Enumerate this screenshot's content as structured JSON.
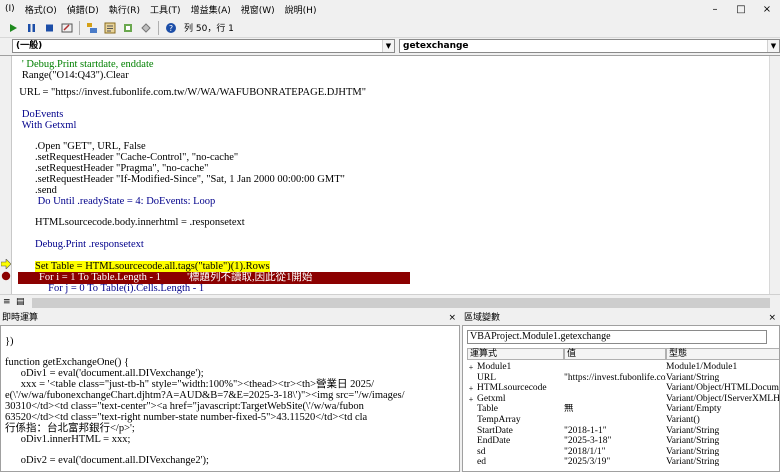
{
  "menu": {
    "items": [
      "(I)",
      "格式(O)",
      "偵錯(D)",
      "執行(R)",
      "工具(T)",
      "增益集(A)",
      "視窗(W)",
      "說明(H)"
    ]
  },
  "window_controls": [
    "–",
    "□",
    "×"
  ],
  "toolbar": {
    "position": "列 50，行 1"
  },
  "dropdowns": {
    "object": "(一般)",
    "procedure": "getexchange"
  },
  "code": {
    "lines": [
      {
        "indent": "   ",
        "text": "' Debug.Print startdate, enddate",
        "style": "comment"
      },
      {
        "indent": "   ",
        "text": "Range(\"O14:Q43\").Clear",
        "style": "normal"
      },
      {
        "indent": "",
        "text": "",
        "style": "normal"
      },
      {
        "indent": "  ",
        "text": "URL = \"https://invest.fubonlife.com.tw/W/WA/WAFUBONRATEPAGE.DJHTM\"",
        "style": "normal"
      },
      {
        "indent": "",
        "text": "",
        "style": "normal"
      },
      {
        "indent": "   ",
        "text": "DoEvents",
        "style": "keyword"
      },
      {
        "indent": "   ",
        "text": "With Getxml",
        "style": "keyword"
      },
      {
        "indent": "",
        "text": "",
        "style": "normal"
      },
      {
        "indent": "        ",
        "text": ".Open \"GET\", URL, False",
        "style": "normal"
      },
      {
        "indent": "        ",
        "text": ".setRequestHeader \"Cache-Control\", \"no-cache\"",
        "style": "normal"
      },
      {
        "indent": "        ",
        "text": ".setRequestHeader \"Pragma\", \"no-cache\"",
        "style": "normal"
      },
      {
        "indent": "        ",
        "text": ".setRequestHeader \"If-Modified-Since\", \"Sat, 1 Jan 2000 00:00:00 GMT\"",
        "style": "normal"
      },
      {
        "indent": "        ",
        "text": ".send",
        "style": "normal"
      },
      {
        "indent": "         ",
        "text": "Do Until .readyState = 4: DoEvents: Loop",
        "style": "keyword"
      },
      {
        "indent": "",
        "text": "",
        "style": "normal"
      },
      {
        "indent": "        ",
        "text": "HTMLsourcecode.body.innerhtml = .responsetext",
        "style": "normal"
      },
      {
        "indent": "",
        "text": "",
        "style": "normal"
      },
      {
        "indent": "        ",
        "text": "Debug.Print .responsetext",
        "style": "keyword"
      },
      {
        "indent": "",
        "text": "",
        "style": "normal"
      },
      {
        "indent": "        ",
        "text": "Set Table = HTMLsourcecode.all.tags(\"table\")(1).Rows",
        "style": "exec"
      },
      {
        "indent": "        ",
        "text": "For i = 1 To Table.Length - 1          '標題列不讀取,因此從1開始",
        "style": "breakpoint"
      },
      {
        "indent": "             ",
        "text": "For j = 0 To Table(i).Cells.Length - 1",
        "style": "keyword"
      }
    ]
  },
  "immediate": {
    "title": "即時運算",
    "lines": [
      "})",
      "",
      "function getExchangeOne() {",
      "      oDiv1 = eval('document.all.DIVexchange');",
      "      xxx = '<table class=\"just-tb-h\" style=\"width:100%\"><thead><tr><th>營業日 2025/",
      "e(\\'/w/wa/fubonexchangeChart.djhtm?A=AUD&B=7&E=2025-3-18\\')\"><img src=\"/w/images/",
      "30310</td><td class=\"text-center\"><a href=\"javascript:TargetWebSite(\\'/w/wa/fubon",
      "63520</td><td class=\"text-right number-state number-fixed-5\">43.11520</td><td cla",
      "行係指：台北富邦銀行</p>';",
      "      oDiv1.innerHTML = xxx;",
      "",
      "      oDiv2 = eval('document.all.DIVexchange2');"
    ]
  },
  "locals": {
    "title": "區域變數",
    "context": "VBAProject.Module1.getexchange",
    "columns": [
      "運算式",
      "值",
      "型態"
    ],
    "rows": [
      {
        "exp": "+",
        "name": "Module1",
        "value": "",
        "type": "Module1/Module1"
      },
      {
        "exp": "",
        "name": "URL",
        "value": "\"https://invest.fubonlife.com.t",
        "type": "Variant/String"
      },
      {
        "exp": "+",
        "name": "HTMLsourcecode",
        "value": "",
        "type": "Variant/Object/HTMLDocume"
      },
      {
        "exp": "+",
        "name": "Getxml",
        "value": "",
        "type": "Variant/Object/IServerXMLH"
      },
      {
        "exp": "",
        "name": "Table",
        "value": "無",
        "type": "Variant/Empty"
      },
      {
        "exp": "",
        "name": "TempArray",
        "value": "",
        "type": "Variant()"
      },
      {
        "exp": "",
        "name": "StartDate",
        "value": "\"2018-1-1\"",
        "type": "Variant/String"
      },
      {
        "exp": "",
        "name": "EndDate",
        "value": "\"2025-3-18\"",
        "type": "Variant/String"
      },
      {
        "exp": "",
        "name": "sd",
        "value": "\"2018/1/1\"",
        "type": "Variant/String"
      },
      {
        "exp": "",
        "name": "ed",
        "value": "\"2025/3/19\"",
        "type": "Variant/String"
      }
    ]
  },
  "colors": {
    "keyword": "#00008b",
    "comment": "#008000",
    "exec_highlight": "#ffff00",
    "breakpoint": "#8b0000"
  }
}
